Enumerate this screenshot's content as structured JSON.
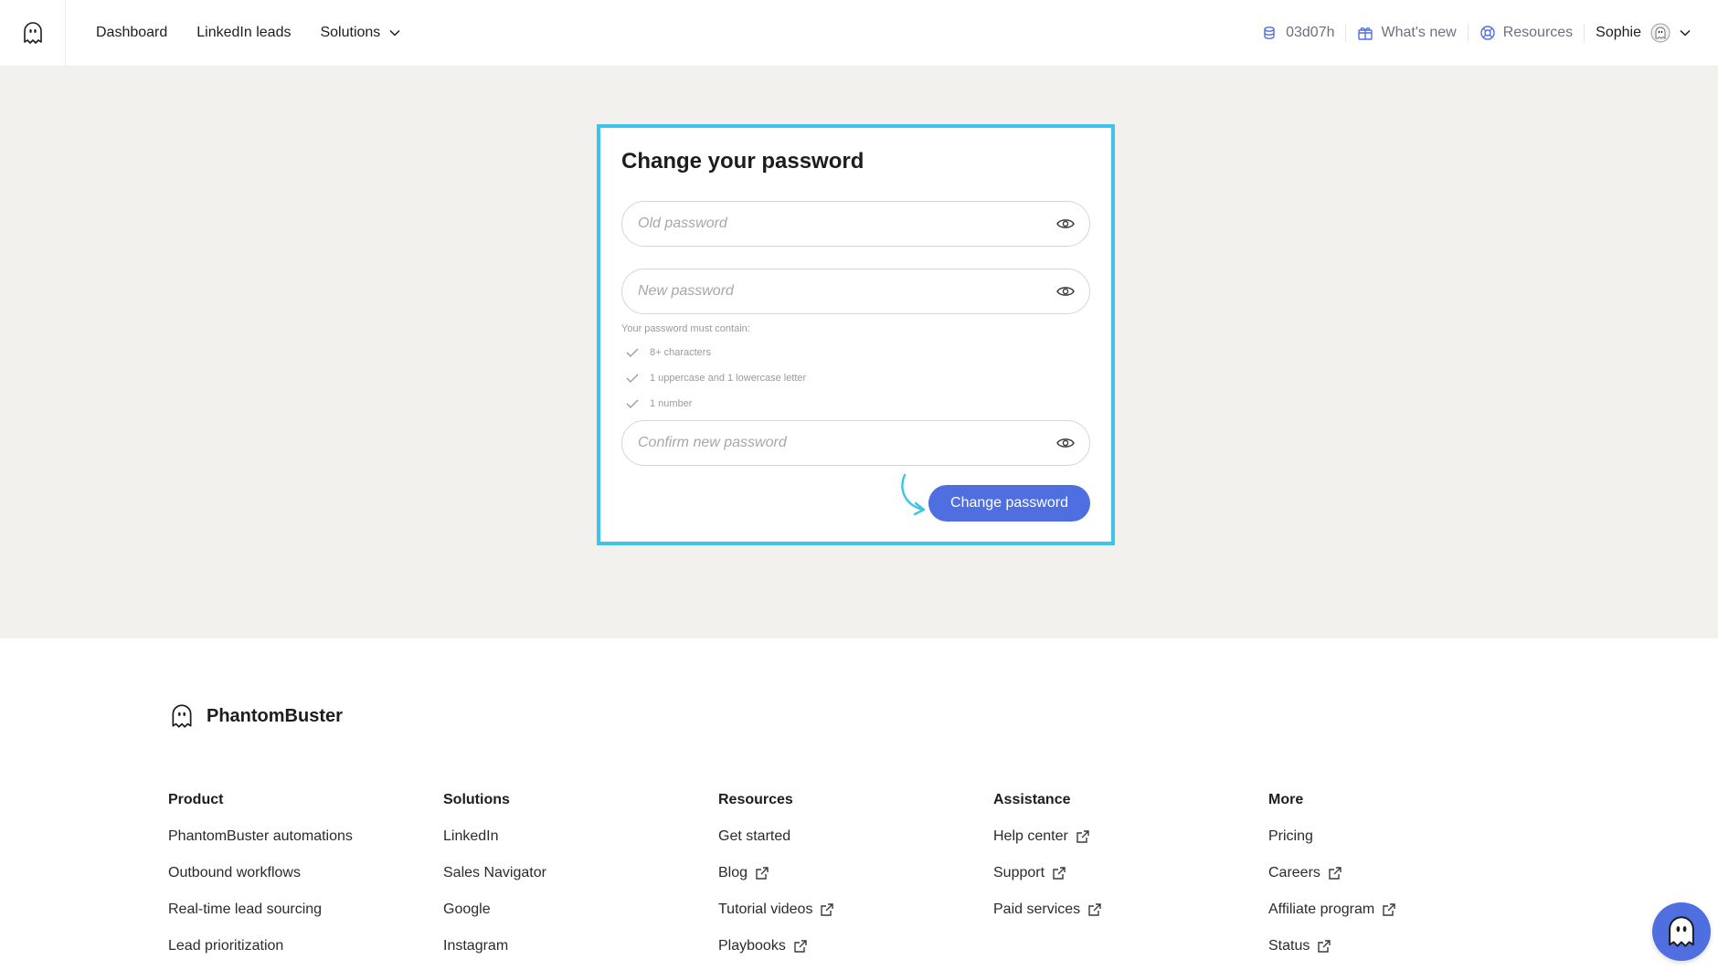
{
  "nav": {
    "items": [
      {
        "label": "Dashboard"
      },
      {
        "label": "LinkedIn leads"
      },
      {
        "label": "Solutions"
      }
    ],
    "time_credits": "03d07h",
    "whats_new": "What's new",
    "resources": "Resources",
    "user_name": "Sophie"
  },
  "card": {
    "title": "Change your password",
    "old_placeholder": "Old password",
    "new_placeholder": "New password",
    "confirm_placeholder": "Confirm new password",
    "rules_title": "Your password must contain:",
    "rules": [
      "8+ characters",
      "1 uppercase and 1 lowercase letter",
      "1 number"
    ],
    "submit_label": "Change password"
  },
  "footer": {
    "brand": "PhantomBuster",
    "columns": [
      {
        "title": "Product",
        "links": [
          {
            "label": "PhantomBuster automations",
            "external": false
          },
          {
            "label": "Outbound workflows",
            "external": false
          },
          {
            "label": "Real-time lead sourcing",
            "external": false
          },
          {
            "label": "Lead prioritization",
            "external": false
          }
        ]
      },
      {
        "title": "Solutions",
        "links": [
          {
            "label": "LinkedIn",
            "external": false
          },
          {
            "label": "Sales Navigator",
            "external": false
          },
          {
            "label": "Google",
            "external": false
          },
          {
            "label": "Instagram",
            "external": false
          }
        ]
      },
      {
        "title": "Resources",
        "links": [
          {
            "label": "Get started",
            "external": false
          },
          {
            "label": "Blog",
            "external": true
          },
          {
            "label": "Tutorial videos",
            "external": true
          },
          {
            "label": "Playbooks",
            "external": true
          }
        ]
      },
      {
        "title": "Assistance",
        "links": [
          {
            "label": "Help center",
            "external": true
          },
          {
            "label": "Support",
            "external": true
          },
          {
            "label": "Paid services",
            "external": true
          }
        ]
      },
      {
        "title": "More",
        "links": [
          {
            "label": "Pricing",
            "external": false
          },
          {
            "label": "Careers",
            "external": true
          },
          {
            "label": "Affiliate program",
            "external": true
          },
          {
            "label": "Status",
            "external": true
          }
        ]
      }
    ]
  },
  "colors": {
    "accent": "#4f6fe0",
    "highlight_border": "#3ec4e8",
    "page_bg": "#f3f1ee"
  },
  "icons": [
    "ghost-logo-icon",
    "chevron-down-icon",
    "credits-icon",
    "gift-icon",
    "lifebuoy-icon",
    "eye-icon",
    "check-icon",
    "external-link-icon",
    "chat-ghost-icon"
  ]
}
